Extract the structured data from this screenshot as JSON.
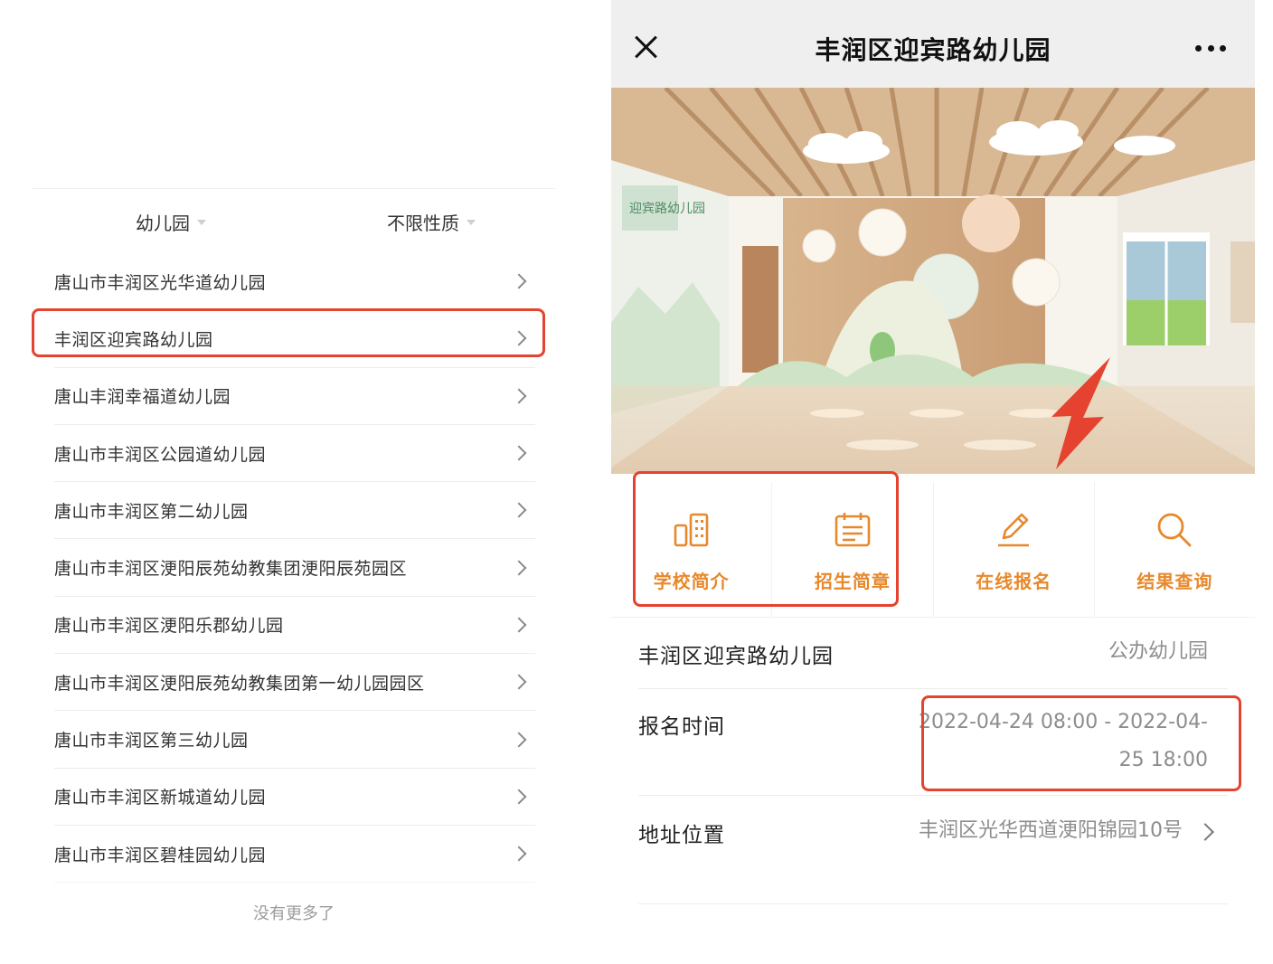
{
  "list_page": {
    "filters": {
      "type_label": "幼儿园",
      "nature_label": "不限性质"
    },
    "schools": [
      "唐山市丰润区光华道幼儿园",
      "丰润区迎宾路幼儿园",
      "唐山丰润幸福道幼儿园",
      "唐山市丰润区公园道幼儿园",
      "唐山市丰润区第二幼儿园",
      "唐山市丰润区浭阳辰苑幼教集团浭阳辰苑园区",
      "唐山市丰润区浭阳乐郡幼儿园",
      "唐山市丰润区浭阳辰苑幼教集团第一幼儿园园区",
      "唐山市丰润区第三幼儿园",
      "唐山市丰润区新城道幼儿园",
      "唐山市丰润区碧桂园幼儿园"
    ],
    "footer": "没有更多了"
  },
  "detail_page": {
    "title": "丰润区迎宾路幼儿园",
    "close_icon": "close-icon",
    "more_icon": "more-icon",
    "hero_sign": "迎宾路幼儿园",
    "tabs": [
      {
        "label": "学校简介",
        "icon": "building-icon"
      },
      {
        "label": "招生简章",
        "icon": "calendar-icon"
      },
      {
        "label": "在线报名",
        "icon": "pencil-icon"
      },
      {
        "label": "结果查询",
        "icon": "search-icon"
      }
    ],
    "school_name": "丰润区迎宾路幼儿园",
    "school_type": "公办幼儿园",
    "signup_label": "报名时间",
    "signup_time": "2022-04-24 08:00 - 2022-04-25 18:00",
    "address_label": "地址位置",
    "address": "丰润区光华西道浭阳锦园10号"
  },
  "colors": {
    "accent": "#e7882b",
    "highlight": "#e5432f",
    "nav_bg": "#efefef"
  }
}
